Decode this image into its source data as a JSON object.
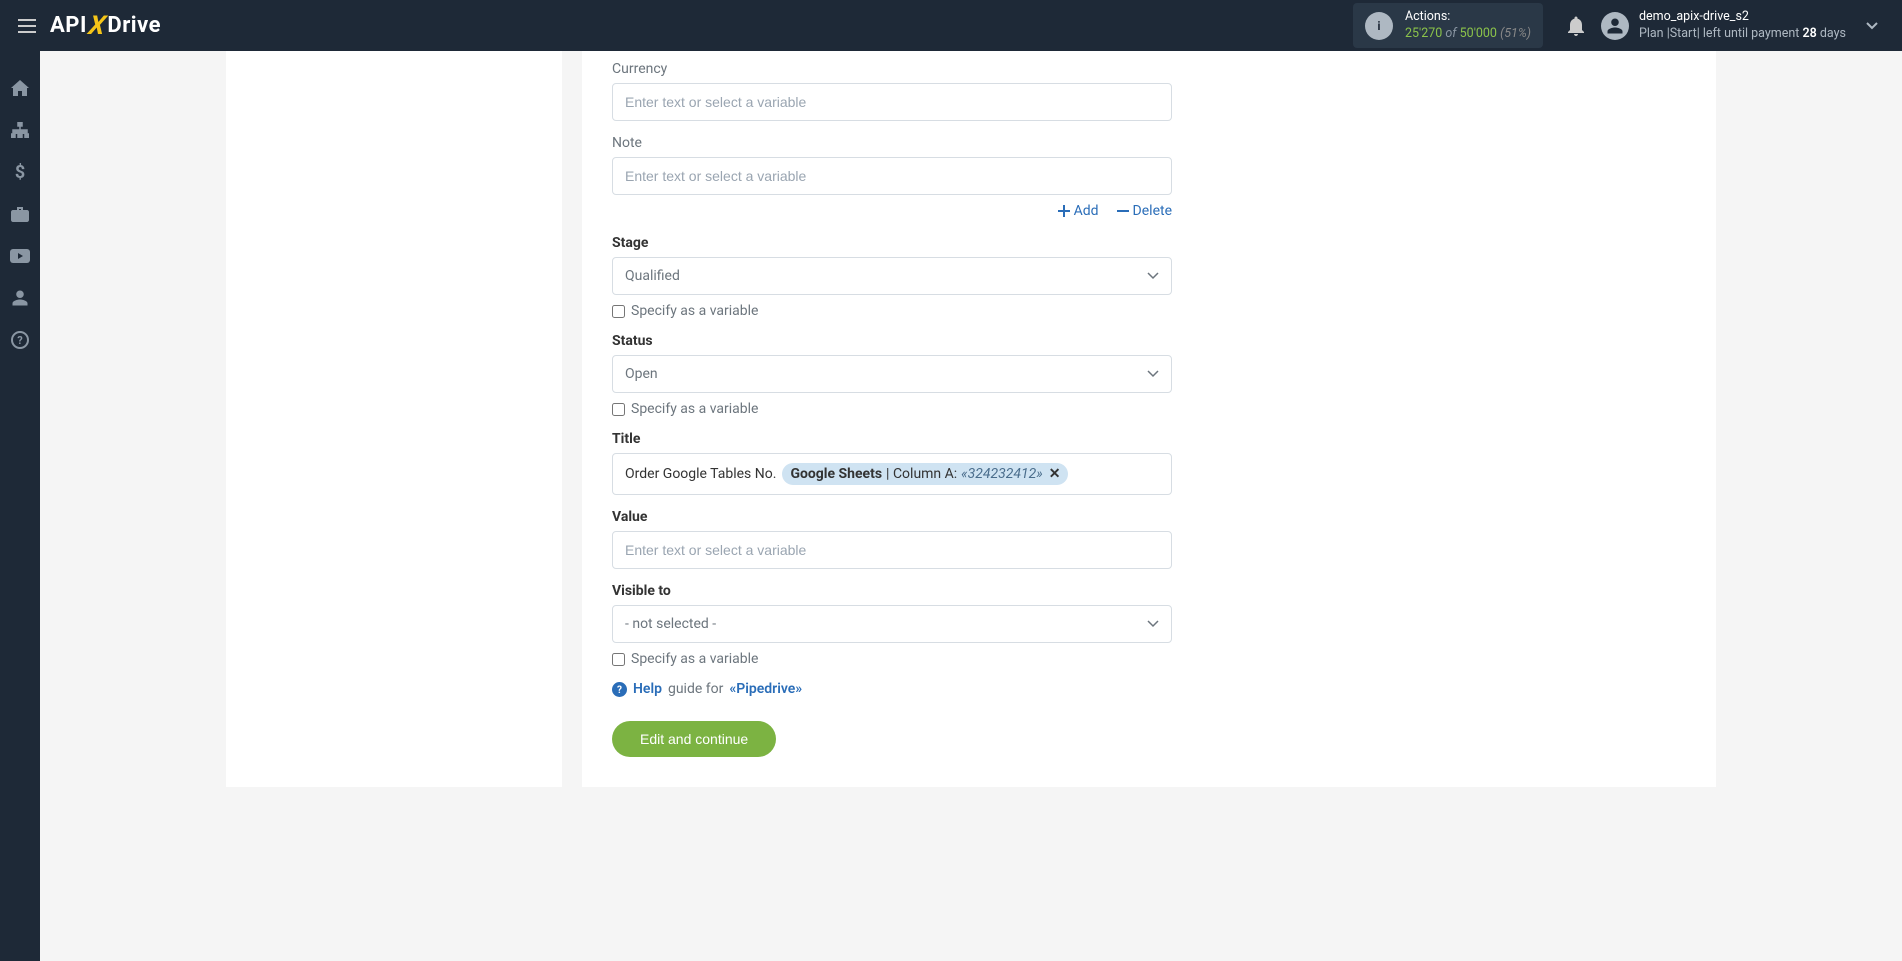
{
  "header": {
    "logo_pre": "API",
    "logo_x": "X",
    "logo_post": "Drive",
    "actions_label": "Actions:",
    "actions_used": "25'270",
    "actions_of": "of",
    "actions_total": "50'000",
    "actions_pct": "(51%)",
    "user_name": "demo_apix-drive_s2",
    "plan_label": "Plan",
    "plan_name": "Start",
    "plan_left": "left until payment",
    "plan_days": "28",
    "plan_days_unit": "days"
  },
  "form": {
    "currency_label": "Currency",
    "note_label": "Note",
    "placeholder": "Enter text or select a variable",
    "add_label": "Add",
    "delete_label": "Delete",
    "stage_label": "Stage",
    "stage_value": "Qualified",
    "specify_var": "Specify as a variable",
    "status_label": "Status",
    "status_value": "Open",
    "title_label": "Title",
    "title_prefix": "Order Google Tables No.",
    "title_tag_source": "Google Sheets",
    "title_tag_col": "| Column A:",
    "title_tag_val": "«324232412»",
    "value_label": "Value",
    "visible_label": "Visible to",
    "visible_value": "- not selected -",
    "help_word": "Help",
    "help_guide": "guide for",
    "help_service": "«Pipedrive»",
    "submit": "Edit and continue"
  }
}
